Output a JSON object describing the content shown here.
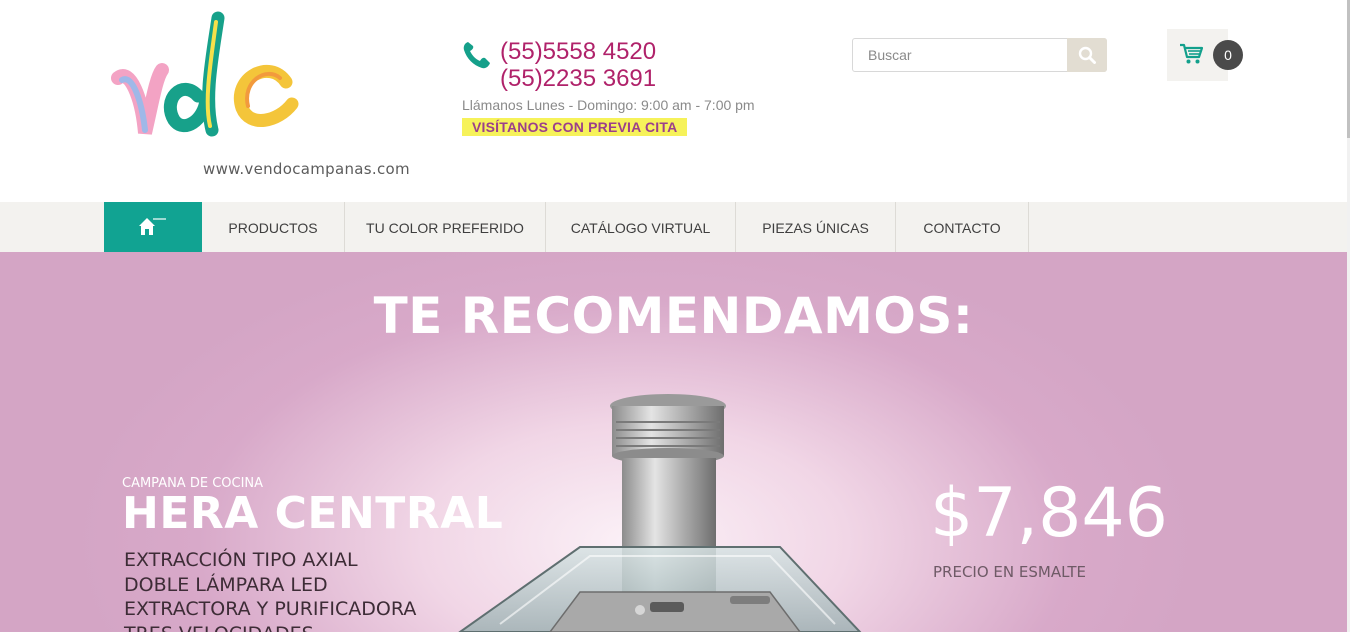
{
  "header": {
    "logo_text": "vdc",
    "logo_url_text": "www.vendocampanas.com",
    "phones": [
      "(55)5558 4520",
      "(55)2235 3691"
    ],
    "hours": "Llámanos Lunes - Domingo: 9:00 am - 7:00 pm",
    "visit_badge": "VISÍTANOS CON PREVIA CITA",
    "phone_icon": "phone-icon"
  },
  "search": {
    "placeholder": "Buscar",
    "value": "",
    "icon": "search-icon"
  },
  "cart": {
    "icon": "cart-icon",
    "count": "0"
  },
  "nav": {
    "home_icon": "home-icon",
    "items": [
      {
        "label": "PRODUCTOS"
      },
      {
        "label": "TU COLOR PREFERIDO"
      },
      {
        "label": "CATÁLOGO VIRTUAL"
      },
      {
        "label": "PIEZAS ÚNICAS"
      },
      {
        "label": "CONTACTO"
      }
    ]
  },
  "hero": {
    "title": "TE RECOMENDAMOS:",
    "eyebrow": "CAMPANA DE COCINA",
    "product_name": "HERA CENTRAL",
    "features": [
      "EXTRACCIÓN TIPO AXIAL",
      "DOBLE LÁMPARA LED",
      "EXTRACTORA Y PURIFICADORA",
      "TRES VELOCIDADES"
    ],
    "price": "$7,846",
    "price_label": "PRECIO EN ESMALTE"
  },
  "colors": {
    "accent_teal": "#11a392",
    "phone_magenta": "#b0226a",
    "badge_yellow": "#f6f25a",
    "hero_pink": "#d4a5c5"
  }
}
